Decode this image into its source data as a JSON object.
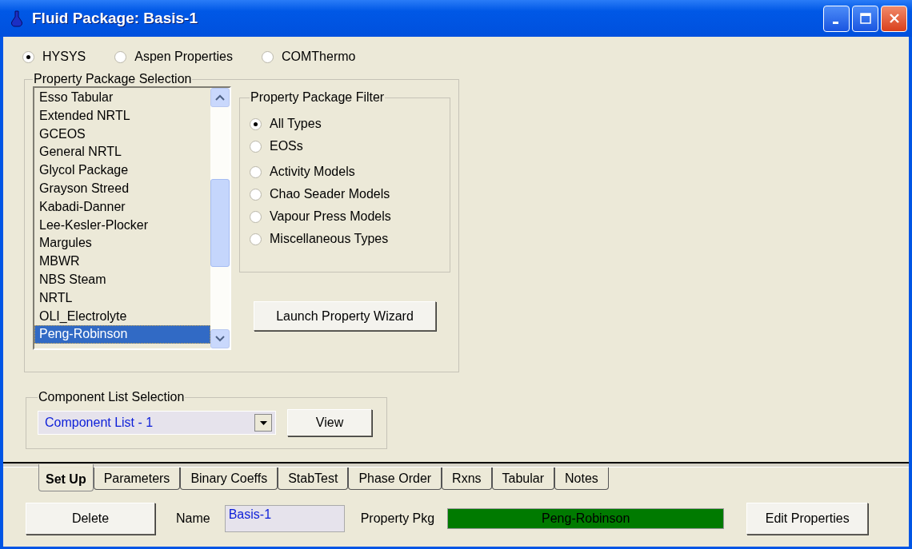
{
  "window": {
    "title": "Fluid Package: Basis-1"
  },
  "engines": [
    {
      "label": "HYSYS",
      "selected": true
    },
    {
      "label": "Aspen Properties",
      "selected": false
    },
    {
      "label": "COMThermo",
      "selected": false
    }
  ],
  "package_selection": {
    "title": "Property Package Selection",
    "items": [
      {
        "label": "Esso Tabular",
        "selected": false
      },
      {
        "label": "Extended NRTL",
        "selected": false
      },
      {
        "label": "GCEOS",
        "selected": false
      },
      {
        "label": "General NRTL",
        "selected": false
      },
      {
        "label": "Glycol Package",
        "selected": false
      },
      {
        "label": "Grayson Streed",
        "selected": false
      },
      {
        "label": "Kabadi-Danner",
        "selected": false
      },
      {
        "label": "Lee-Kesler-Plocker",
        "selected": false
      },
      {
        "label": "Margules",
        "selected": false
      },
      {
        "label": "MBWR",
        "selected": false
      },
      {
        "label": "NBS Steam",
        "selected": false
      },
      {
        "label": "NRTL",
        "selected": false
      },
      {
        "label": "OLI_Electrolyte",
        "selected": false
      },
      {
        "label": "Peng-Robinson",
        "selected": true
      }
    ]
  },
  "filter": {
    "title": "Property Package Filter",
    "options": [
      {
        "label": "All Types",
        "selected": true
      },
      {
        "label": "EOSs",
        "selected": false
      },
      {
        "label": "Activity Models",
        "selected": false
      },
      {
        "label": "Chao Seader Models",
        "selected": false
      },
      {
        "label": "Vapour Press Models",
        "selected": false
      },
      {
        "label": "Miscellaneous Types",
        "selected": false
      }
    ]
  },
  "wizard_button": "Launch Property Wizard",
  "component_list": {
    "title": "Component List Selection",
    "value": "Component List - 1",
    "button": "View"
  },
  "tabs": [
    {
      "label": "Set Up",
      "selected": true
    },
    {
      "label": "Parameters",
      "selected": false
    },
    {
      "label": "Binary Coeffs",
      "selected": false
    },
    {
      "label": "StabTest",
      "selected": false
    },
    {
      "label": "Phase Order",
      "selected": false
    },
    {
      "label": "Rxns",
      "selected": false
    },
    {
      "label": "Tabular",
      "selected": false
    },
    {
      "label": "Notes",
      "selected": false
    }
  ],
  "footer": {
    "delete": "Delete",
    "name_label": "Name",
    "name_value": "Basis-1",
    "pkg_label": "Property Pkg",
    "pkg_value": "Peng-Robinson",
    "edit": "Edit Properties"
  }
}
